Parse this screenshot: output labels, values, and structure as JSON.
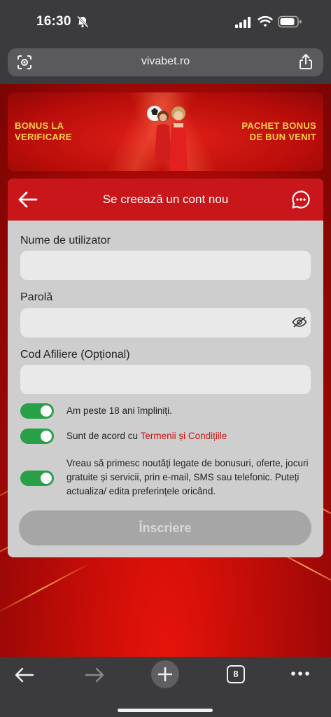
{
  "status_bar": {
    "time": "16:30"
  },
  "browser": {
    "url": "vivabet.ro",
    "tab_count": "8"
  },
  "banner": {
    "left_line1": "BONUS LA",
    "left_line2": "VERIFICARE",
    "right_line1": "PACHET BONUS",
    "right_line2": "DE BUN VENIT"
  },
  "form": {
    "title": "Se creează un cont nou",
    "username_label": "Nume de utilizator",
    "username_value": "",
    "password_label": "Parolă",
    "password_value": "",
    "affiliate_label": "Cod Afiliere (Opțional)",
    "affiliate_value": "",
    "toggle_age_text": "Am peste 18 ani împliniți.",
    "toggle_age_on": true,
    "toggle_terms_prefix": "Sunt de acord cu ",
    "toggle_terms_link": "Termenii și Condițiile",
    "toggle_terms_on": true,
    "toggle_marketing_text": "Vreau să primesc noutăți legate de bonusuri, oferte, jocuri gratuite și servicii, prin e-mail, SMS sau telefonic. Puteți actualiza/ edita preferințele oricând.",
    "toggle_marketing_on": true,
    "submit_label": "Înscriere"
  },
  "colors": {
    "brand_red": "#c8161a",
    "toggle_on": "#27a047",
    "banner_gold": "#ffd44a"
  }
}
